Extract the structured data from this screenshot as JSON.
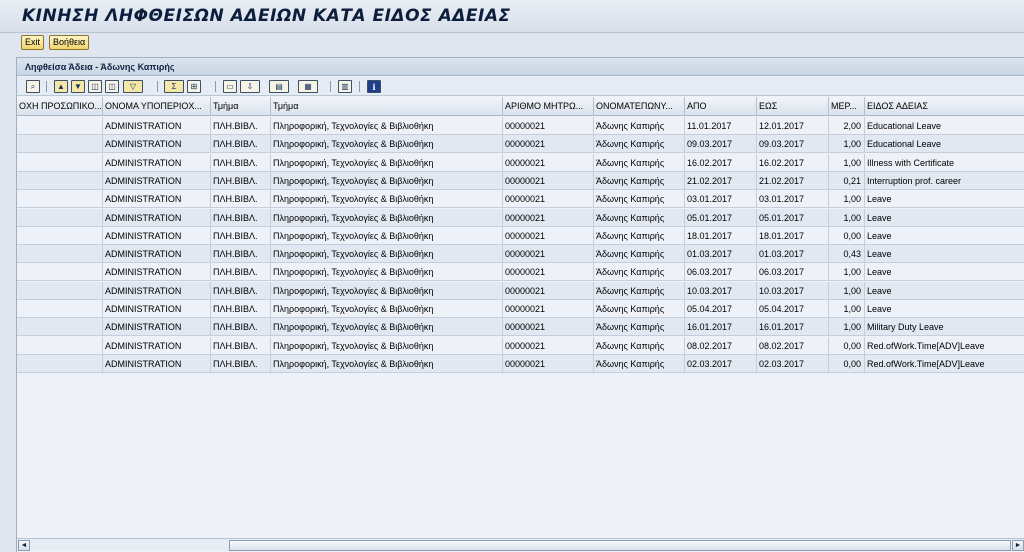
{
  "window": {
    "title": "ΚΙΝΗΣΗ ΛΗΦΘΕΙΣΩΝ ΑΔΕΙΩΝ ΚΑΤΑ ΕΙΔΟΣ ΑΔΕΙΑΣ"
  },
  "app_toolbar": {
    "exit_label": "Exit",
    "help_label": "Βοήθεια"
  },
  "panel": {
    "title": "Ληφθείσα Άδεια - Άδωνης Καπιρής"
  },
  "toolbar_icons": [
    "details-icon",
    "sort-ascending-icon",
    "sort-descending-icon",
    "find-icon",
    "find-next-icon",
    "filter-icon",
    "sum-icon",
    "subtotal-icon",
    "print-preview-icon",
    "export-icon",
    "layout-icon",
    "choose-layout-icon",
    "abc-analysis-icon",
    "info-icon"
  ],
  "columns": [
    "ΟΧΗ ΠΡΟΣΩΠΙΚΟ...",
    "ΟΝΟΜΑ ΥΠΟΠΕΡΙΟΧ...",
    "Τμήμα",
    "Τμήμα",
    "ΑΡΙΘΜΟ ΜΗΤΡΩ...",
    "ΟΝΟΜΑΤΕΠΩΝΥ...",
    "ΑΠΟ",
    "ΕΩΣ",
    "ΜΕΡ...",
    "ΕΙΔΟΣ ΑΔΕΙΑΣ"
  ],
  "rows": [
    [
      "",
      "ADMINISTRATION",
      "ΠΛΗ.ΒΙΒΛ.",
      "Πληροφορική, Τεχνολογίες & Βιβλιοθήκη",
      "00000021",
      "Άδωνης Καπιρής",
      "11.01.2017",
      "12.01.2017",
      "2,00",
      "Educational Leave"
    ],
    [
      "",
      "ADMINISTRATION",
      "ΠΛΗ.ΒΙΒΛ.",
      "Πληροφορική, Τεχνολογίες & Βιβλιοθήκη",
      "00000021",
      "Άδωνης Καπιρής",
      "09.03.2017",
      "09.03.2017",
      "1,00",
      "Educational Leave"
    ],
    [
      "",
      "ADMINISTRATION",
      "ΠΛΗ.ΒΙΒΛ.",
      "Πληροφορική, Τεχνολογίες & Βιβλιοθήκη",
      "00000021",
      "Άδωνης Καπιρής",
      "16.02.2017",
      "16.02.2017",
      "1,00",
      "Illness with Certificate"
    ],
    [
      "",
      "ADMINISTRATION",
      "ΠΛΗ.ΒΙΒΛ.",
      "Πληροφορική, Τεχνολογίες & Βιβλιοθήκη",
      "00000021",
      "Άδωνης Καπιρής",
      "21.02.2017",
      "21.02.2017",
      "0,21",
      "Interruption prof. career"
    ],
    [
      "",
      "ADMINISTRATION",
      "ΠΛΗ.ΒΙΒΛ.",
      "Πληροφορική, Τεχνολογίες & Βιβλιοθήκη",
      "00000021",
      "Άδωνης Καπιρής",
      "03.01.2017",
      "03.01.2017",
      "1,00",
      "Leave"
    ],
    [
      "",
      "ADMINISTRATION",
      "ΠΛΗ.ΒΙΒΛ.",
      "Πληροφορική, Τεχνολογίες & Βιβλιοθήκη",
      "00000021",
      "Άδωνης Καπιρής",
      "05.01.2017",
      "05.01.2017",
      "1,00",
      "Leave"
    ],
    [
      "",
      "ADMINISTRATION",
      "ΠΛΗ.ΒΙΒΛ.",
      "Πληροφορική, Τεχνολογίες & Βιβλιοθήκη",
      "00000021",
      "Άδωνης Καπιρής",
      "18.01.2017",
      "18.01.2017",
      "0,00",
      "Leave"
    ],
    [
      "",
      "ADMINISTRATION",
      "ΠΛΗ.ΒΙΒΛ.",
      "Πληροφορική, Τεχνολογίες & Βιβλιοθήκη",
      "00000021",
      "Άδωνης Καπιρής",
      "01.03.2017",
      "01.03.2017",
      "0,43",
      "Leave"
    ],
    [
      "",
      "ADMINISTRATION",
      "ΠΛΗ.ΒΙΒΛ.",
      "Πληροφορική, Τεχνολογίες & Βιβλιοθήκη",
      "00000021",
      "Άδωνης Καπιρής",
      "06.03.2017",
      "06.03.2017",
      "1,00",
      "Leave"
    ],
    [
      "",
      "ADMINISTRATION",
      "ΠΛΗ.ΒΙΒΛ.",
      "Πληροφορική, Τεχνολογίες & Βιβλιοθήκη",
      "00000021",
      "Άδωνης Καπιρής",
      "10.03.2017",
      "10.03.2017",
      "1,00",
      "Leave"
    ],
    [
      "",
      "ADMINISTRATION",
      "ΠΛΗ.ΒΙΒΛ.",
      "Πληροφορική, Τεχνολογίες & Βιβλιοθήκη",
      "00000021",
      "Άδωνης Καπιρής",
      "05.04.2017",
      "05.04.2017",
      "1,00",
      "Leave"
    ],
    [
      "",
      "ADMINISTRATION",
      "ΠΛΗ.ΒΙΒΛ.",
      "Πληροφορική, Τεχνολογίες & Βιβλιοθήκη",
      "00000021",
      "Άδωνης Καπιρής",
      "16.01.2017",
      "16.01.2017",
      "1,00",
      "Military Duty Leave"
    ],
    [
      "",
      "ADMINISTRATION",
      "ΠΛΗ.ΒΙΒΛ.",
      "Πληροφορική, Τεχνολογίες & Βιβλιοθήκη",
      "00000021",
      "Άδωνης Καπιρής",
      "08.02.2017",
      "08.02.2017",
      "0,00",
      "Red.ofWork.Time[ADV]Leave"
    ],
    [
      "",
      "ADMINISTRATION",
      "ΠΛΗ.ΒΙΒΛ.",
      "Πληροφορική, Τεχνολογίες & Βιβλιοθήκη",
      "00000021",
      "Άδωνης Καπιρής",
      "02.03.2017",
      "02.03.2017",
      "0,00",
      "Red.ofWork.Time[ADV]Leave"
    ]
  ],
  "scrollbar": {
    "left_arrow": "◄",
    "right_arrow": "►"
  }
}
